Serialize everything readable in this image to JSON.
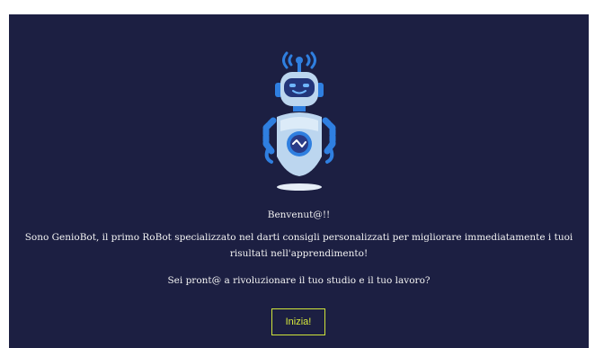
{
  "welcome": {
    "greeting": "Benvenut@!!",
    "intro": "Sono GenioBot, il primo RoBot specializzato nel darti consigli personalizzati per migliorare immediatamente i tuoi risultati nell'apprendimento!",
    "question": "Sei pront@ a rivoluzionare il tuo studio e il tuo lavoro?",
    "start_label": "Inizia!"
  },
  "colors": {
    "background": "#1c1f42",
    "text": "#f2f2f2",
    "accent": "#cfe43a",
    "robot_blue": "#2f7fe0",
    "robot_light": "#bcd6ef"
  },
  "icons": {
    "robot": "robot-mascot-icon",
    "signal": "wifi-signal-icon"
  }
}
